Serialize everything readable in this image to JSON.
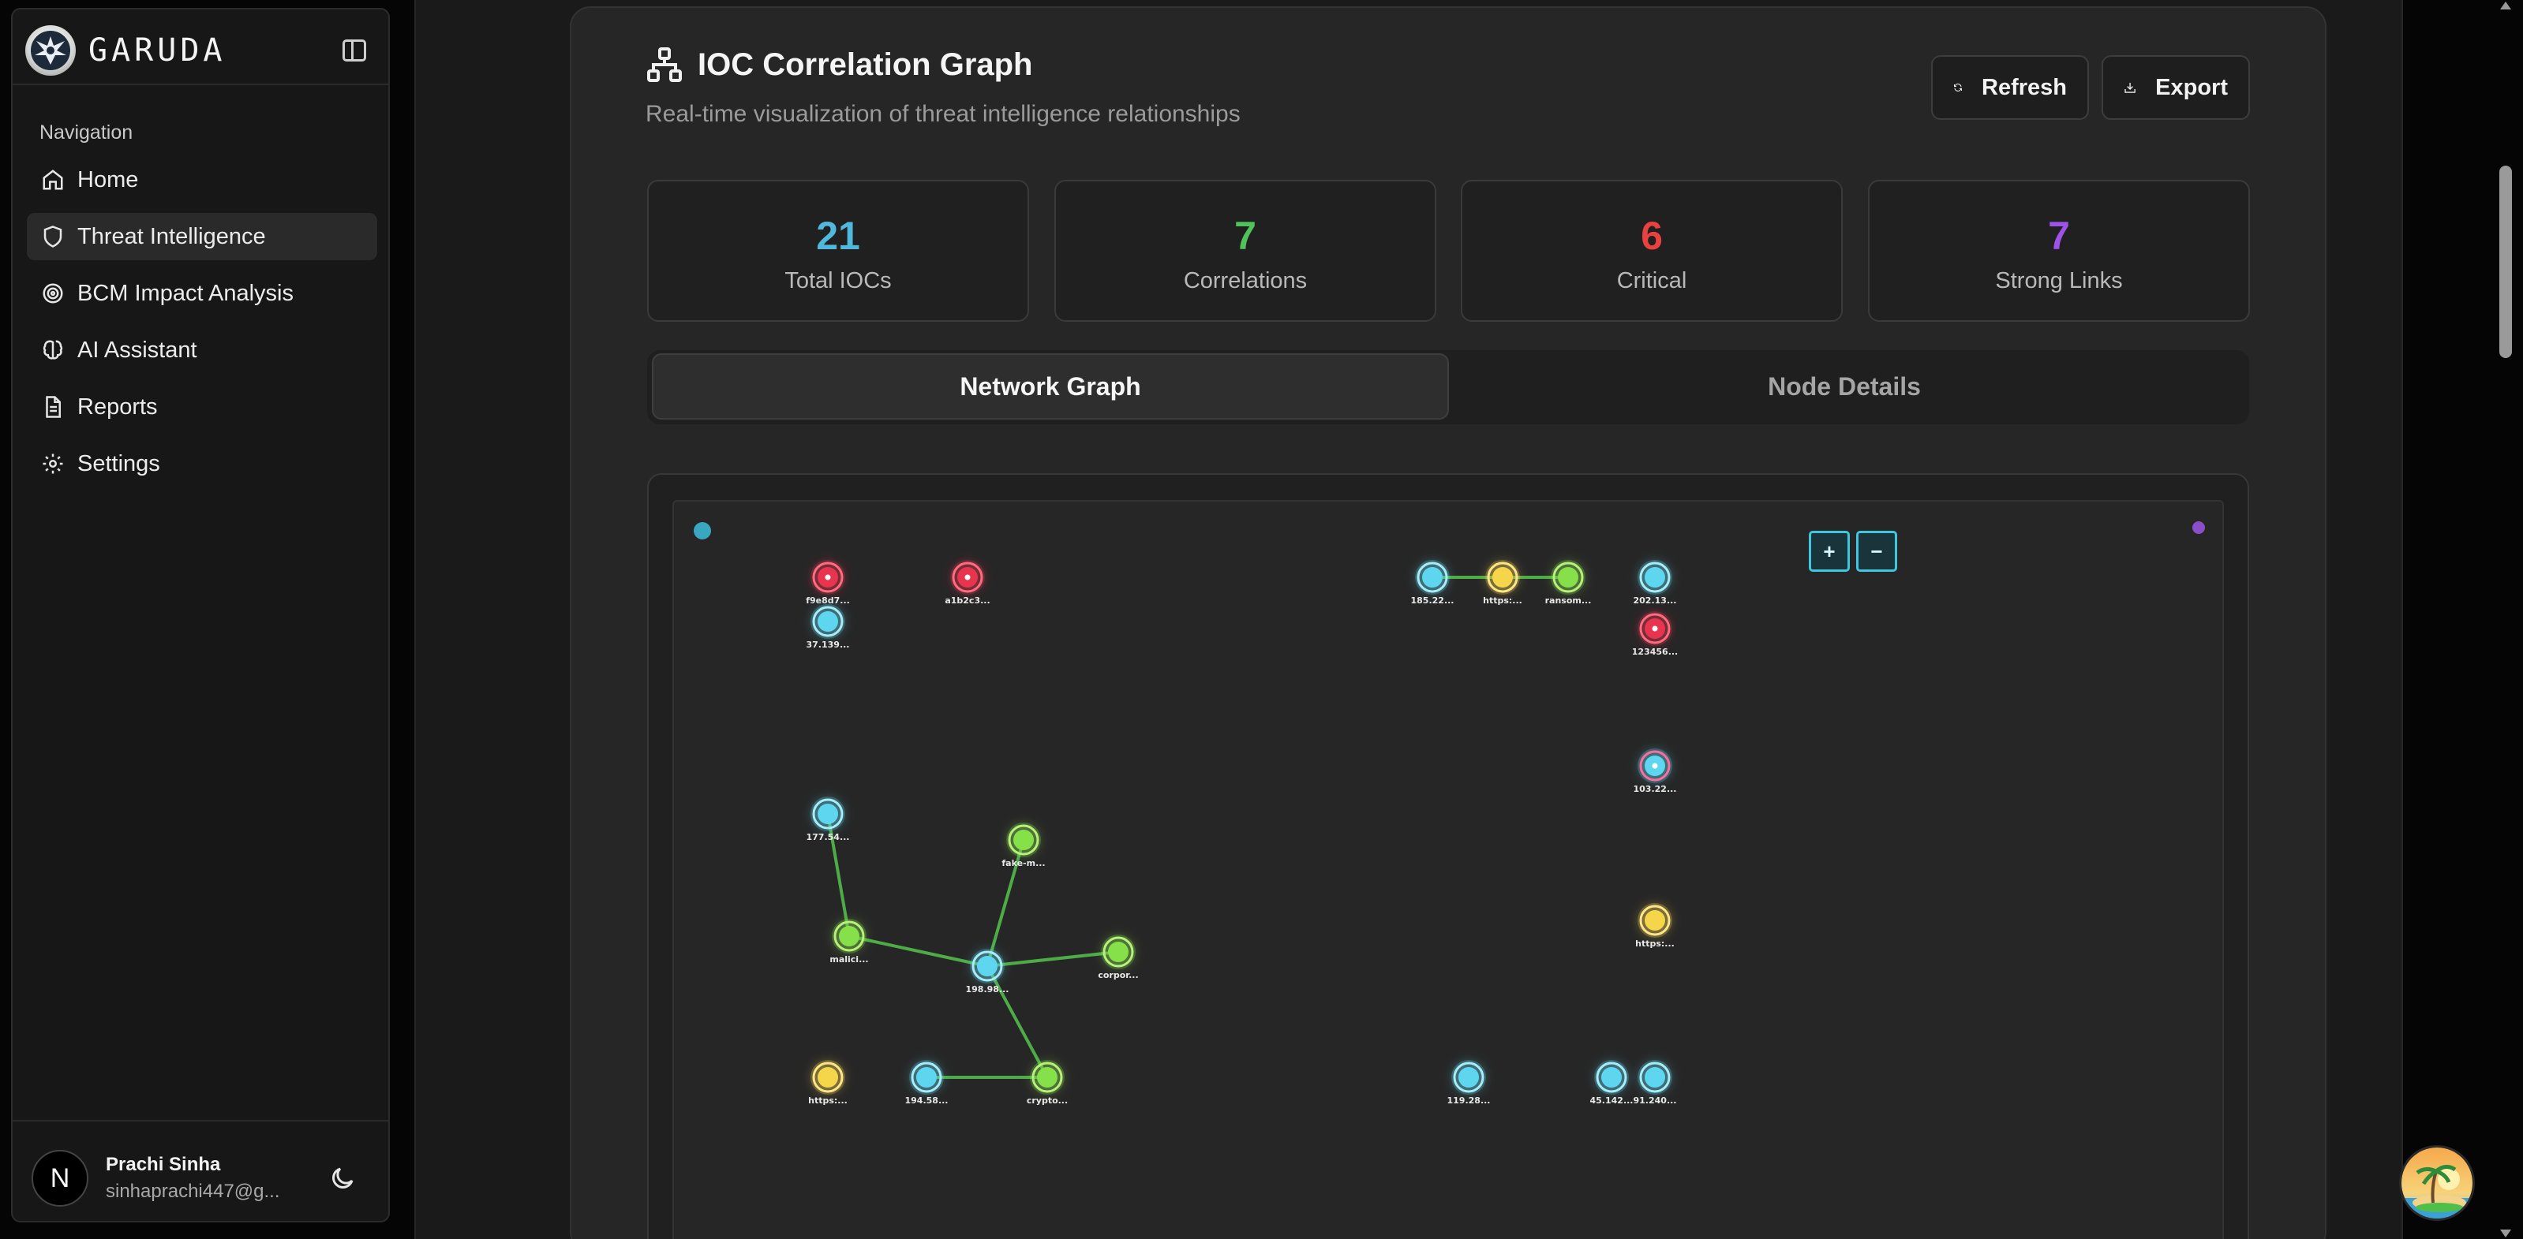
{
  "app": {
    "name": "GARUDA",
    "logo_text": "GARUDA"
  },
  "sidebar": {
    "group_label": "Navigation",
    "items": [
      {
        "label": "Home",
        "icon": "home-icon",
        "active": false
      },
      {
        "label": "Threat Intelligence",
        "icon": "shield-icon",
        "active": true
      },
      {
        "label": "BCM Impact Analysis",
        "icon": "target-icon",
        "active": false
      },
      {
        "label": "AI Assistant",
        "icon": "brain-icon",
        "active": false
      },
      {
        "label": "Reports",
        "icon": "document-icon",
        "active": false
      },
      {
        "label": "Settings",
        "icon": "gear-icon",
        "active": false
      }
    ],
    "user": {
      "initial": "N",
      "name": "Prachi Sinha",
      "email": "sinhaprachi447@g..."
    }
  },
  "header": {
    "title": "IOC Correlation Graph",
    "subtitle": "Real-time visualization of threat intelligence relationships",
    "refresh_label": "Refresh",
    "export_label": "Export"
  },
  "stats": [
    {
      "value": "21",
      "label": "Total IOCs",
      "color": "#4fb8dc"
    },
    {
      "value": "7",
      "label": "Correlations",
      "color": "#4ec45a"
    },
    {
      "value": "6",
      "label": "Critical",
      "color": "#e8413f"
    },
    {
      "value": "7",
      "label": "Strong Links",
      "color": "#9d52e8"
    }
  ],
  "tabs": {
    "network": "Network Graph",
    "details": "Node Details"
  },
  "zoom": {
    "in_label": "+",
    "out_label": "−"
  },
  "colors": {
    "critical": "#e8344f",
    "ip": "#5fd6ef",
    "domain": "#86e04a",
    "url": "#f5d54a",
    "edge": "#55c44c"
  },
  "graph": {
    "nodes": [
      {
        "id": "n1",
        "label": "f9e8d7...",
        "kind": "critical"
      },
      {
        "id": "n2",
        "label": "a1b2c3...",
        "kind": "critical"
      },
      {
        "id": "n3",
        "label": "37.139...",
        "kind": "ip"
      },
      {
        "id": "n4",
        "label": "185.22...",
        "kind": "ip"
      },
      {
        "id": "n5",
        "label": "https:...",
        "kind": "url"
      },
      {
        "id": "n6",
        "label": "ransom...",
        "kind": "domain"
      },
      {
        "id": "n7",
        "label": "202.13...",
        "kind": "ip"
      },
      {
        "id": "n8",
        "label": "123456...",
        "kind": "critical"
      },
      {
        "id": "n9",
        "label": "103.22...",
        "kind": "critical-ip"
      },
      {
        "id": "n10",
        "label": "177.54...",
        "kind": "ip"
      },
      {
        "id": "n11",
        "label": "fake-m...",
        "kind": "domain"
      },
      {
        "id": "n12",
        "label": "malici...",
        "kind": "domain"
      },
      {
        "id": "n13",
        "label": "198.98...",
        "kind": "ip"
      },
      {
        "id": "n14",
        "label": "corpor...",
        "kind": "domain"
      },
      {
        "id": "n15",
        "label": "https:...",
        "kind": "url"
      },
      {
        "id": "n16",
        "label": "https:...",
        "kind": "url"
      },
      {
        "id": "n17",
        "label": "194.58...",
        "kind": "ip"
      },
      {
        "id": "n18",
        "label": "crypto...",
        "kind": "domain"
      },
      {
        "id": "n19",
        "label": "119.28...",
        "kind": "ip"
      },
      {
        "id": "n20",
        "label": "45.142...",
        "kind": "ip"
      },
      {
        "id": "n21",
        "label": "91.240...",
        "kind": "ip"
      }
    ],
    "edges": [
      [
        "n4",
        "n5"
      ],
      [
        "n5",
        "n6"
      ],
      [
        "n10",
        "n12"
      ],
      [
        "n12",
        "n13"
      ],
      [
        "n13",
        "n11"
      ],
      [
        "n13",
        "n14"
      ],
      [
        "n13",
        "n18"
      ],
      [
        "n17",
        "n18"
      ]
    ]
  }
}
